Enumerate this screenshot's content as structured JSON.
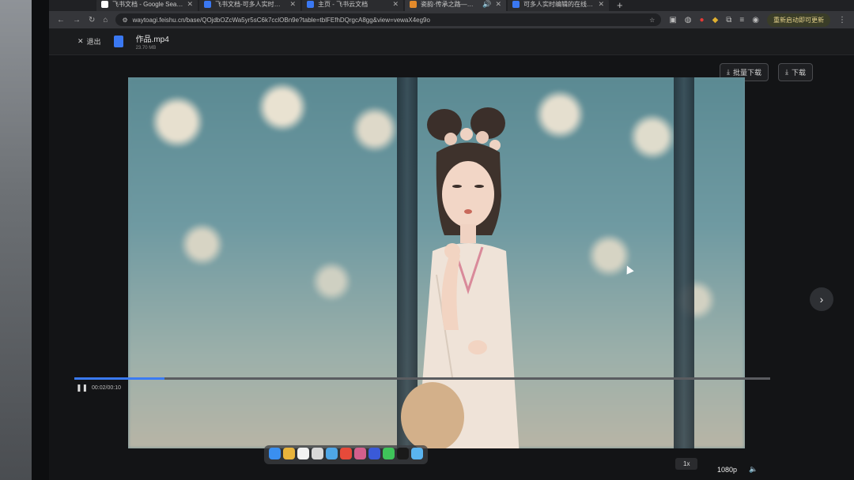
{
  "browser": {
    "tabs": [
      {
        "title": "飞书文档 - Google Search",
        "color": "#ffffff",
        "active": false
      },
      {
        "title": "飞书文档-可多人实时编辑的在线",
        "color": "#3a78f2",
        "active": false
      },
      {
        "title": "主页 - 飞书云文档",
        "color": "#3a78f2",
        "active": false
      },
      {
        "title": "瓷韵·传承之路—视频制作说",
        "color": "#e38a2b",
        "active": true
      },
      {
        "title": "可多人实时编辑的在线文档软件",
        "color": "#3a78f2",
        "active": false
      }
    ],
    "new_tab_label": "+",
    "url": "waytoagi.feishu.cn/base/QOjdbOZcWa5yr5sC6k7cclOBn9e?table=tblFEfhDQrgcA8gg&view=vewaX4eg9o",
    "update_label": "重新启动即可更新"
  },
  "app": {
    "back_label": "退出",
    "file_name": "作品.mp4",
    "file_size": "23.70 MB",
    "batch_download_label": "批量下载",
    "download_label": "下载"
  },
  "player": {
    "time": "00:02/00:10",
    "progress_pct": 13,
    "speed": "1x",
    "quality": "1080p"
  },
  "colors": {
    "accent": "#3a7af2"
  }
}
